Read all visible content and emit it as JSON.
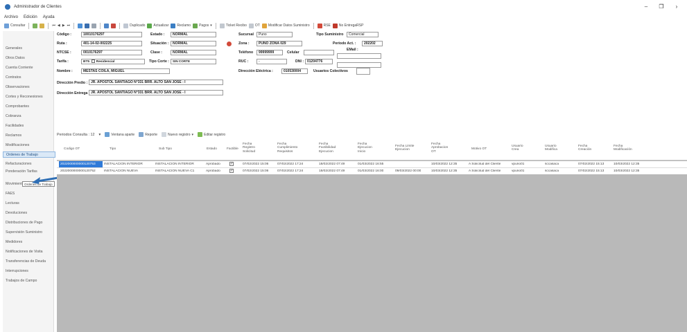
{
  "window": {
    "title": "Administrador de Clientes",
    "controls": [
      "–",
      "❐",
      "›"
    ]
  },
  "menu": [
    "Archivo",
    "Edición",
    "Ayuda"
  ],
  "toolbar": {
    "consultar": "Consultar",
    "duplicado": "Duplicado",
    "actualizar": "Actualizar",
    "reclamo": "Reclamo",
    "pagos": "Pagos",
    "ticket": "Ticket Recibo",
    "ot": "OT",
    "modificar": "Modificar Datos Suministro",
    "rsf": "RSE",
    "no_entrega": "No EntregaRSP"
  },
  "sidebar": {
    "items": [
      "Generales",
      "Otros Datos",
      "Cuenta Corriente",
      "Contratos",
      "Observaciones",
      "Cortes y Reconexiones",
      "Comprobantes",
      "Cobranza",
      "Facilidades",
      "Reclamos",
      "Modificaciones",
      "Ordenes de Trabajo",
      "Refacturaciones",
      "Ponderación Tarifas",
      "Movimientos",
      "FAES",
      "Lecturas",
      "Devoluciones",
      "Distribuciones de Pago",
      "Supervisión Suministro",
      "Medidores",
      "Notificaciones de Visita",
      "Transferencias de Deuda",
      "Interrupciones",
      "Trabajos de Campo"
    ],
    "tooltip": "Ordenes de Trabajo"
  },
  "form": {
    "codigo_label": "Código :",
    "codigo": "10010176297",
    "estado_label": "Estado :",
    "estado": "NORMAL",
    "sucursal_label": "Sucursal",
    "sucursal": "Puno",
    "tipo_sum_label": "Tipo Suministro",
    "tipo_sum": "Comercial",
    "ruta_label": "Ruta :",
    "ruta": "401-14-02-002225",
    "situacion_label": "Situación :",
    "situacion": "NORMAL",
    "zona_label": "Zona :",
    "zona": "PUNO ZONA 029",
    "periodo_label": "Periodo Act. :",
    "periodo": "202202",
    "ntcse_label": "NTCSE :",
    "ntcse": "0010176297",
    "clase_label": "Clase :",
    "clase": "NORMAL",
    "telefono_label": "Teléfono",
    "telefono": "99999999",
    "celular_label": "Celular",
    "email_label": "EMail :",
    "tarifa_label": "Tarifa :",
    "tarifa": "BT5",
    "residencial": "Residencial",
    "tipo_corte_label": "Tipo Corte :",
    "tipo_corte": "SIN CORTE",
    "ruc_label": "RUC :",
    "ruc": "-",
    "dni_label": "DNI :",
    "dni": "01204776",
    "nombre_label": "Nombre :",
    "nombre": "MESTAS COILA, MIGUEL",
    "direccion_elec_label": "Dirección Eléctrica :",
    "direccion_elec": "010530004",
    "usuarios_label": "Usuarios Colectivos",
    "dir_predio_label": "Dirección Predio :",
    "dir_predio": "JR. APOSTOL SANTIAGO N°331 BRR. ALTO SAN JOSE - I",
    "dir_entrega_label": "Dirección Entrega :",
    "dir_entrega": "JR. APOSTOL SANTIAGO N°331 BRR. ALTO SAN JOSE - I"
  },
  "gridbar": {
    "periodos": "Periodos Consulta : 12",
    "ventana": "Ventana aparte",
    "reporte": "Reporte",
    "nuevo": "Nuevo registro",
    "editar": "Editar registro"
  },
  "grid": {
    "headers": [
      "Codigo OT",
      "Tipo",
      "Sub Tipo",
      "Estado",
      "Factible",
      "Fecha\nRegistro\nSolicitud",
      "Fecha\nCumplimiento\nRequisitos",
      "Fecha\nFactibilidad\nEjecucion",
      "Fecha\nEjecucion\nInicio",
      "Fecha Limite\nEjecucion",
      "Fecha\nAprobacion\nOT",
      "Motivo OT",
      "Usuario\nCrea",
      "Usuario\nModifica",
      "Fecha\nCreación",
      "Fecha\nModificación"
    ],
    "rows": [
      [
        "2022000000000120753",
        "INSTALACION INTERIOR",
        "INSTALACION INTERIOR",
        "Aprobado",
        "✓",
        "07/02/2022 15:06",
        "07/02/2022 17:24",
        "18/02/2022 07:49",
        "01/03/2022 16:55",
        "",
        "10/03/2022 12:35",
        "A Solicitud del Cliente",
        "vpuno01",
        "sccasaca",
        "07/02/2022 15:13",
        "10/03/2022 12:35"
      ],
      [
        "2022000000000120752",
        "INSTALACION NUEVA",
        "INSTALACION NUEVA C1",
        "Aprobado",
        "✓",
        "07/02/2022 15:06",
        "07/02/2022 17:24",
        "18/02/2022 07:49",
        "01/03/2022 16:00",
        "09/03/2022 00:00",
        "10/03/2022 12:35",
        "A Solicitud del Cliente",
        "vpuno01",
        "sccasaca",
        "07/02/2022 15:13",
        "10/03/2022 12:35"
      ]
    ]
  },
  "colors": {
    "accent": "#2f7ad8",
    "sidebar_active": "#dbe9f7",
    "grid_empty": "#b9b9b9"
  }
}
